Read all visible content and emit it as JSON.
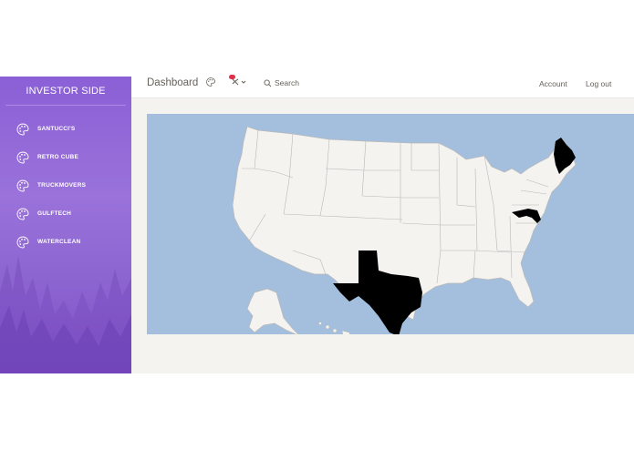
{
  "sidebar": {
    "brand": "INVESTOR SIDE",
    "items": [
      {
        "label": "SANTUCCI'S",
        "icon": "palette-icon"
      },
      {
        "label": "RETRO CUBE",
        "icon": "palette-icon"
      },
      {
        "label": "TRUCKMOVERS",
        "icon": "palette-icon"
      },
      {
        "label": "GULFTECH",
        "icon": "palette-icon"
      },
      {
        "label": "WATERCLEAN",
        "icon": "palette-icon"
      }
    ]
  },
  "topbar": {
    "title": "Dashboard",
    "search_label": "Search",
    "account_label": "Account",
    "logout_label": "Log out"
  },
  "map": {
    "highlighted_states": [
      "Texas",
      "Maine",
      "Maryland"
    ],
    "colors": {
      "ocean": "#a4bfdd",
      "land": "#f4f3ef",
      "highlight": "#000000",
      "border": "#b8b8b8"
    }
  },
  "colors": {
    "sidebar_top": "#8b5fd6",
    "sidebar_bottom": "#7e4fc6",
    "badge": "#e0304a"
  }
}
